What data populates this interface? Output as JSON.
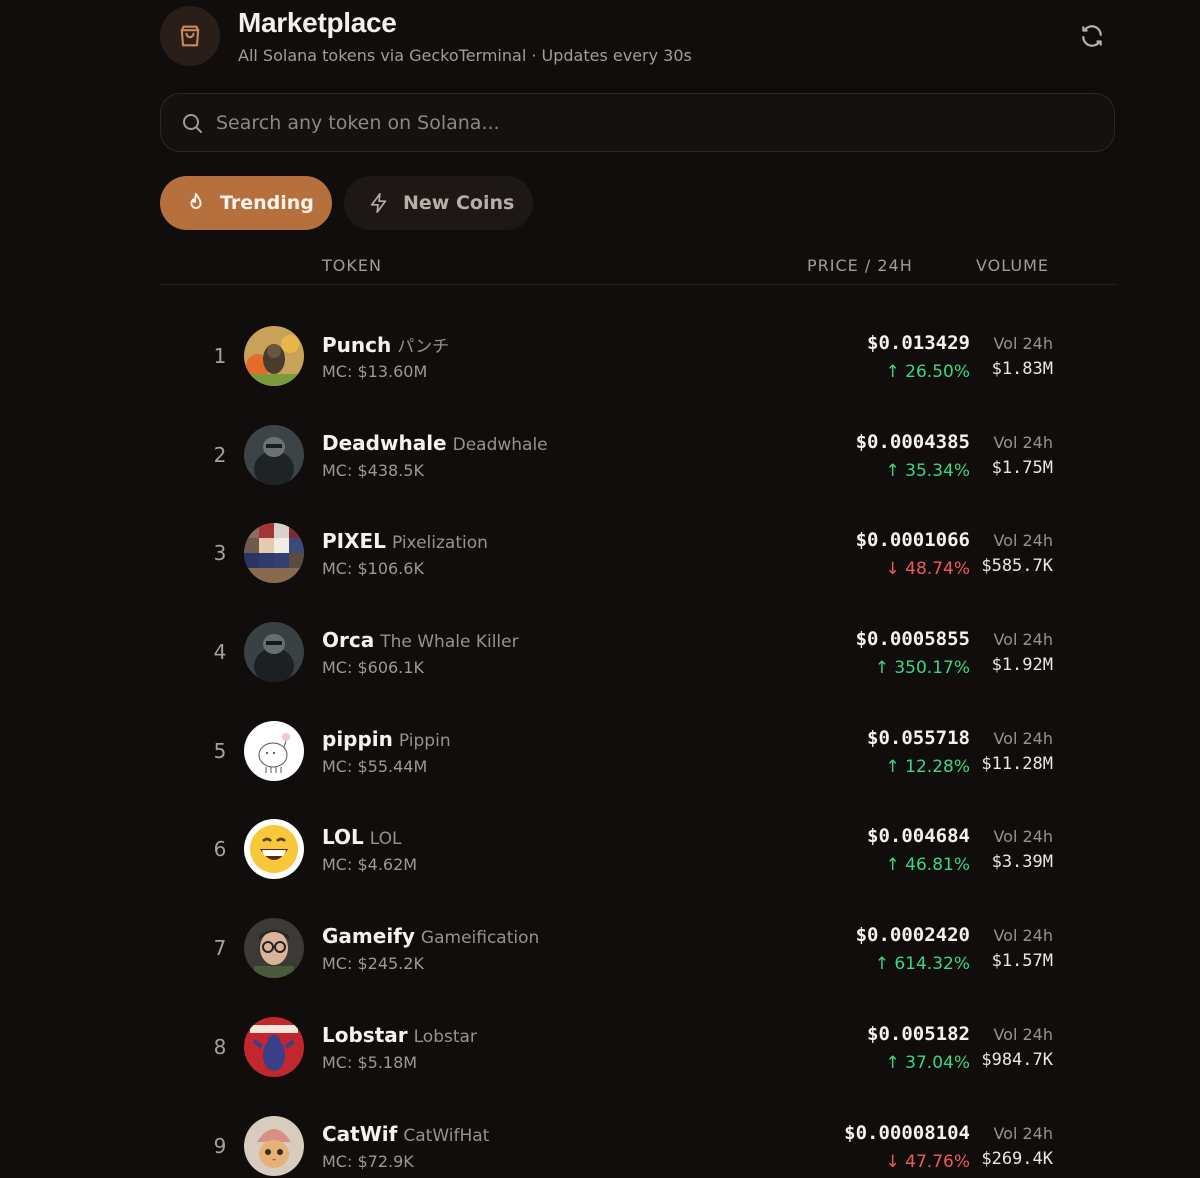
{
  "header": {
    "title": "Marketplace",
    "subtitle": "All Solana tokens via GeckoTerminal · Updates every 30s",
    "icon": "shopping-bag-icon",
    "refresh_icon": "refresh-icon"
  },
  "search": {
    "placeholder": "Search any token on Solana...",
    "value": ""
  },
  "tabs": [
    {
      "label": "Trending",
      "icon": "flame-icon",
      "active": true
    },
    {
      "label": "New Coins",
      "icon": "lightning-icon",
      "active": false
    }
  ],
  "table": {
    "headers": {
      "token": "TOKEN",
      "price": "PRICE / 24H",
      "volume": "VOLUME"
    },
    "rows": [
      {
        "rank": "1",
        "symbol": "Punch",
        "name": "パンチ",
        "mc": "MC: $13.60M",
        "price": "$0.013429",
        "change": "↑ 26.50%",
        "direction": "up",
        "vol_label": "Vol 24h",
        "volume": "$1.83M"
      },
      {
        "rank": "2",
        "symbol": "Deadwhale",
        "name": "Deadwhale",
        "mc": "MC: $438.5K",
        "price": "$0.0004385",
        "change": "↑ 35.34%",
        "direction": "up",
        "vol_label": "Vol 24h",
        "volume": "$1.75M"
      },
      {
        "rank": "3",
        "symbol": "PIXEL",
        "name": "Pixelization",
        "mc": "MC: $106.6K",
        "price": "$0.0001066",
        "change": "↓ 48.74%",
        "direction": "down",
        "vol_label": "Vol 24h",
        "volume": "$585.7K"
      },
      {
        "rank": "4",
        "symbol": "Orca",
        "name": "The Whale Killer",
        "mc": "MC: $606.1K",
        "price": "$0.0005855",
        "change": "↑ 350.17%",
        "direction": "up",
        "vol_label": "Vol 24h",
        "volume": "$1.92M"
      },
      {
        "rank": "5",
        "symbol": "pippin",
        "name": "Pippin",
        "mc": "MC: $55.44M",
        "price": "$0.055718",
        "change": "↑ 12.28%",
        "direction": "up",
        "vol_label": "Vol 24h",
        "volume": "$11.28M"
      },
      {
        "rank": "6",
        "symbol": "LOL",
        "name": "LOL",
        "mc": "MC: $4.62M",
        "price": "$0.004684",
        "change": "↑ 46.81%",
        "direction": "up",
        "vol_label": "Vol 24h",
        "volume": "$3.39M"
      },
      {
        "rank": "7",
        "symbol": "Gameify",
        "name": "Gameification",
        "mc": "MC: $245.2K",
        "price": "$0.0002420",
        "change": "↑ 614.32%",
        "direction": "up",
        "vol_label": "Vol 24h",
        "volume": "$1.57M"
      },
      {
        "rank": "8",
        "symbol": "Lobstar",
        "name": "Lobstar",
        "mc": "MC: $5.18M",
        "price": "$0.005182",
        "change": "↑ 37.04%",
        "direction": "up",
        "vol_label": "Vol 24h",
        "volume": "$984.7K"
      },
      {
        "rank": "9",
        "symbol": "CatWif",
        "name": "CatWifHat",
        "mc": "MC: $72.9K",
        "price": "$0.00008104",
        "change": "↓ 47.76%",
        "direction": "down",
        "vol_label": "Vol 24h",
        "volume": "$269.4K"
      }
    ]
  },
  "colors": {
    "background": "#100d0c",
    "accent": "#b5703e",
    "up": "#3fd67f",
    "down": "#ef5b5b"
  }
}
